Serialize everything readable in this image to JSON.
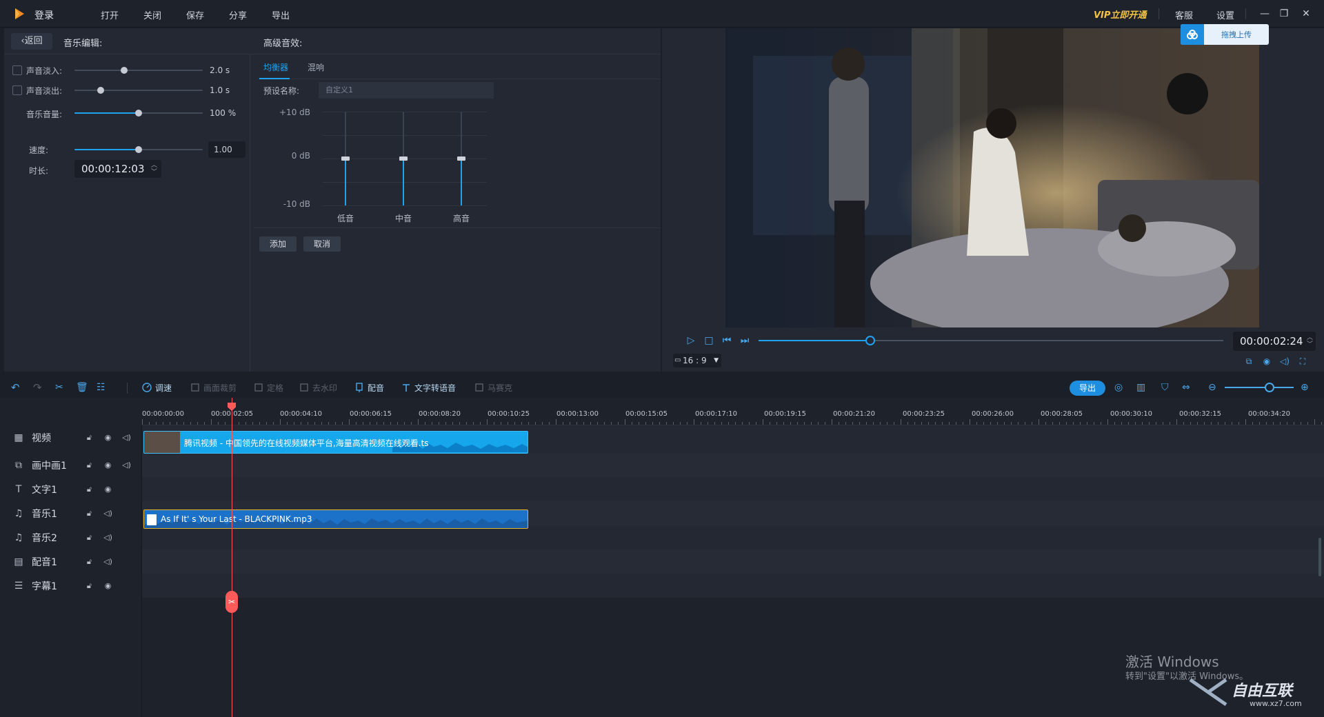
{
  "titlebar": {
    "login": "登录",
    "menu": [
      "打开",
      "关闭",
      "保存",
      "分享",
      "导出"
    ],
    "vip": "VIP立即开通",
    "service": "客服",
    "settings": "设置"
  },
  "editor": {
    "back": "返回",
    "music_edit_title": "音乐编辑:",
    "advanced_title": "高级音效:",
    "fade_in": {
      "label": "声音淡入:",
      "value": "2.0 s",
      "level": 0.4
    },
    "fade_out": {
      "label": "声音淡出:",
      "value": "1.0 s",
      "level": 0.2
    },
    "volume": {
      "label": "音乐音量:",
      "value": "100 %",
      "level": 0.5
    },
    "speed": {
      "label": "速度:",
      "value": "1.00",
      "level": 0.5
    },
    "duration": {
      "label": "时长:",
      "value": "00:00:12:03"
    }
  },
  "advanced": {
    "tabs": [
      "均衡器",
      "混响"
    ],
    "active_tab": 0,
    "preset_label": "预设名称:",
    "preset_value": "自定义1",
    "db_labels": [
      "+10 dB",
      "0 dB",
      "-10 dB"
    ],
    "bands": [
      {
        "label": "低音",
        "db": 0
      },
      {
        "label": "中音",
        "db": 0
      },
      {
        "label": "高音",
        "db": 0
      }
    ],
    "add": "添加",
    "cancel": "取消"
  },
  "preview": {
    "upload": "拖拽上传",
    "time": "00:00:02:24",
    "ratio": "16 : 9",
    "progress": 0.24
  },
  "toolbar": {
    "items": [
      {
        "label": "调速",
        "enabled": true
      },
      {
        "label": "画面裁剪",
        "enabled": false
      },
      {
        "label": "定格",
        "enabled": false
      },
      {
        "label": "去水印",
        "enabled": false
      },
      {
        "label": "配音",
        "enabled": true
      },
      {
        "label": "文字转语音",
        "enabled": true
      },
      {
        "label": "马赛克",
        "enabled": false
      }
    ],
    "export": "导出",
    "zoom": 0.58
  },
  "timeline": {
    "ticks": [
      "00:00:00:00",
      "00:00:02:05",
      "00:00:04:10",
      "00:00:06:15",
      "00:00:08:20",
      "00:00:10:25",
      "00:00:13:00",
      "00:00:15:05",
      "00:00:17:10",
      "00:00:19:15",
      "00:00:21:20",
      "00:00:23:25",
      "00:00:26:00",
      "00:00:28:05",
      "00:00:30:10",
      "00:00:32:15",
      "00:00:34:20"
    ],
    "tracks": [
      {
        "name": "视频",
        "icon": "film-icon"
      },
      {
        "name": "画中画1",
        "icon": "pip-icon"
      },
      {
        "name": "文字1",
        "icon": "text-icon"
      },
      {
        "name": "音乐1",
        "icon": "music-icon"
      },
      {
        "name": "音乐2",
        "icon": "music-icon"
      },
      {
        "name": "配音1",
        "icon": "mic-icon"
      },
      {
        "name": "字幕1",
        "icon": "subtitle-icon"
      }
    ],
    "video_clip": "腾讯视频 - 中国领先的在线视频媒体平台,海量高清视频在线观看.ts",
    "audio_clip": "As If It'    s Your Last - BLACKPINK.mp3"
  },
  "watermark": {
    "line1": "激活 Windows",
    "line2": "转到\"设置\"以激活 Windows。"
  },
  "site": {
    "name": "自由互联",
    "url": "www.xz7.com"
  }
}
